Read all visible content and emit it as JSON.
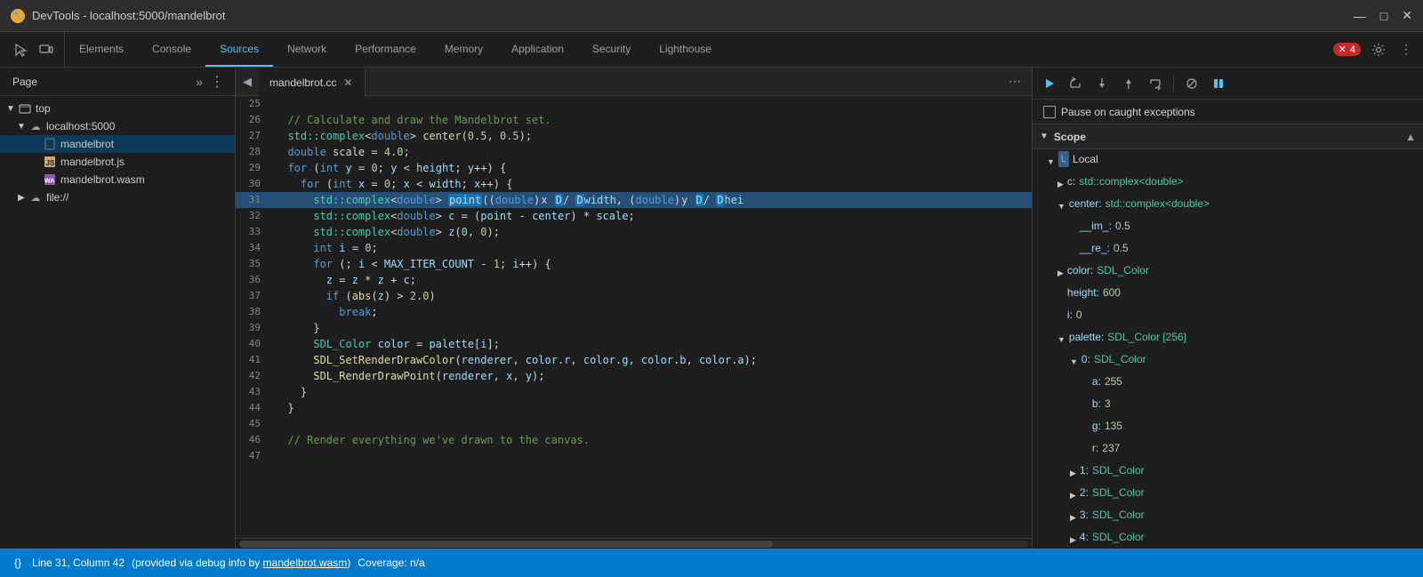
{
  "titleBar": {
    "icon": "🔧",
    "title": "DevTools - localhost:5000/mandelbrot",
    "minimize": "—",
    "maximize": "□",
    "close": "✕"
  },
  "nav": {
    "tabs": [
      {
        "label": "Elements",
        "active": false
      },
      {
        "label": "Console",
        "active": false
      },
      {
        "label": "Sources",
        "active": true
      },
      {
        "label": "Network",
        "active": false
      },
      {
        "label": "Performance",
        "active": false
      },
      {
        "label": "Memory",
        "active": false
      },
      {
        "label": "Application",
        "active": false
      },
      {
        "label": "Security",
        "active": false
      },
      {
        "label": "Lighthouse",
        "active": false
      }
    ],
    "errorCount": "4",
    "errorIcon": "✕"
  },
  "sidebar": {
    "pageLabel": "Page",
    "tree": [
      {
        "level": 0,
        "arrow": "▼",
        "icon": "□",
        "label": "top",
        "type": "folder-open"
      },
      {
        "level": 1,
        "arrow": "▼",
        "icon": "☁",
        "label": "localhost:5000",
        "type": "cloud"
      },
      {
        "level": 2,
        "arrow": "",
        "icon": "📄",
        "label": "mandelbrot",
        "type": "file",
        "active": true
      },
      {
        "level": 2,
        "arrow": "",
        "icon": "📜",
        "label": "mandelbrot.js",
        "type": "js"
      },
      {
        "level": 2,
        "arrow": "",
        "icon": "🔷",
        "label": "mandelbrot.wasm",
        "type": "wasm"
      },
      {
        "level": 1,
        "arrow": "▶",
        "icon": "☁",
        "label": "file://",
        "type": "cloud"
      }
    ]
  },
  "codeTab": {
    "filename": "mandelbrot.cc",
    "closeBtn": "✕"
  },
  "code": {
    "lines": [
      {
        "num": 25,
        "content": "",
        "type": "blank"
      },
      {
        "num": 26,
        "content": "  // Calculate and draw the Mandelbrot set.",
        "type": "comment"
      },
      {
        "num": 27,
        "content": "  std::complex<double> center(0.5, 0.5);",
        "type": "code"
      },
      {
        "num": 28,
        "content": "  double scale = 4.0;",
        "type": "code"
      },
      {
        "num": 29,
        "content": "  for (int y = 0; y < height; y++) {",
        "type": "code"
      },
      {
        "num": 30,
        "content": "    for (int x = 0; x < width; x++) {",
        "type": "code"
      },
      {
        "num": 31,
        "content": "      std::complex<double> point((double)x / width, (double)y / hei",
        "type": "code",
        "highlighted": true
      },
      {
        "num": 32,
        "content": "      std::complex<double> c = (point - center) * scale;",
        "type": "code"
      },
      {
        "num": 33,
        "content": "      std::complex<double> z(0, 0);",
        "type": "code"
      },
      {
        "num": 34,
        "content": "      int i = 0;",
        "type": "code"
      },
      {
        "num": 35,
        "content": "      for (; i < MAX_ITER_COUNT - 1; i++) {",
        "type": "code"
      },
      {
        "num": 36,
        "content": "        z = z * z + c;",
        "type": "code"
      },
      {
        "num": 37,
        "content": "        if (abs(z) > 2.0)",
        "type": "code"
      },
      {
        "num": 38,
        "content": "          break;",
        "type": "code"
      },
      {
        "num": 39,
        "content": "      }",
        "type": "code"
      },
      {
        "num": 40,
        "content": "      SDL_Color color = palette[i];",
        "type": "code"
      },
      {
        "num": 41,
        "content": "      SDL_SetRenderDrawColor(renderer, color.r, color.g, color.b, color.a);",
        "type": "code"
      },
      {
        "num": 42,
        "content": "      SDL_RenderDrawPoint(renderer, x, y);",
        "type": "code"
      },
      {
        "num": 43,
        "content": "    }",
        "type": "code"
      },
      {
        "num": 44,
        "content": "  }",
        "type": "code"
      },
      {
        "num": 45,
        "content": "",
        "type": "blank"
      },
      {
        "num": 46,
        "content": "  // Render everything we've drawn to the canvas.",
        "type": "comment"
      },
      {
        "num": 47,
        "content": "",
        "type": "blank"
      }
    ]
  },
  "debugToolbar": {
    "resume": "▶",
    "stepOver": "↷",
    "stepInto": "↓",
    "stepOut": "↑",
    "stepBack": "↺",
    "deactivate": "⊘",
    "pause": "⏸"
  },
  "pauseException": {
    "label": "Pause on caught exceptions"
  },
  "scope": {
    "title": "Scope",
    "local": {
      "label": "Local",
      "items": [
        {
          "key": "c:",
          "val": "std::complex<double>",
          "type": "expandable"
        },
        {
          "key": "center:",
          "val": "std::complex<double>",
          "type": "expandable"
        },
        {
          "key": "__im_:",
          "val": "0.5",
          "type": "num",
          "indent": 2
        },
        {
          "key": "__re_:",
          "val": "0.5",
          "type": "num",
          "indent": 2
        },
        {
          "key": "color:",
          "val": "SDL_Color",
          "type": "expandable"
        },
        {
          "key": "height:",
          "val": "600",
          "type": "num"
        },
        {
          "key": "i:",
          "val": "0",
          "type": "num"
        },
        {
          "key": "palette:",
          "val": "SDL_Color [256]",
          "type": "expandable"
        },
        {
          "key": "0:",
          "val": "SDL_Color",
          "type": "expandable",
          "indent": 2
        },
        {
          "key": "a:",
          "val": "255",
          "type": "num",
          "indent": 3
        },
        {
          "key": "b:",
          "val": "3",
          "type": "num",
          "indent": 3
        },
        {
          "key": "g:",
          "val": "135",
          "type": "num",
          "indent": 3
        },
        {
          "key": "r:",
          "val": "237",
          "type": "num",
          "indent": 3
        },
        {
          "key": "1:",
          "val": "SDL_Color",
          "type": "expandable",
          "indent": 2
        },
        {
          "key": "2:",
          "val": "SDL_Color",
          "type": "expandable",
          "indent": 2
        },
        {
          "key": "3:",
          "val": "SDL_Color",
          "type": "expandable",
          "indent": 2
        },
        {
          "key": "4:",
          "val": "SDL_Color",
          "type": "expandable",
          "indent": 2
        }
      ]
    }
  },
  "statusBar": {
    "formatBtn": "{}",
    "lineCol": "Line 31, Column 42",
    "debugInfo": "(provided via debug info by",
    "debugFile": "mandelbrot.wasm",
    "coverageLabel": "Coverage: n/a"
  }
}
